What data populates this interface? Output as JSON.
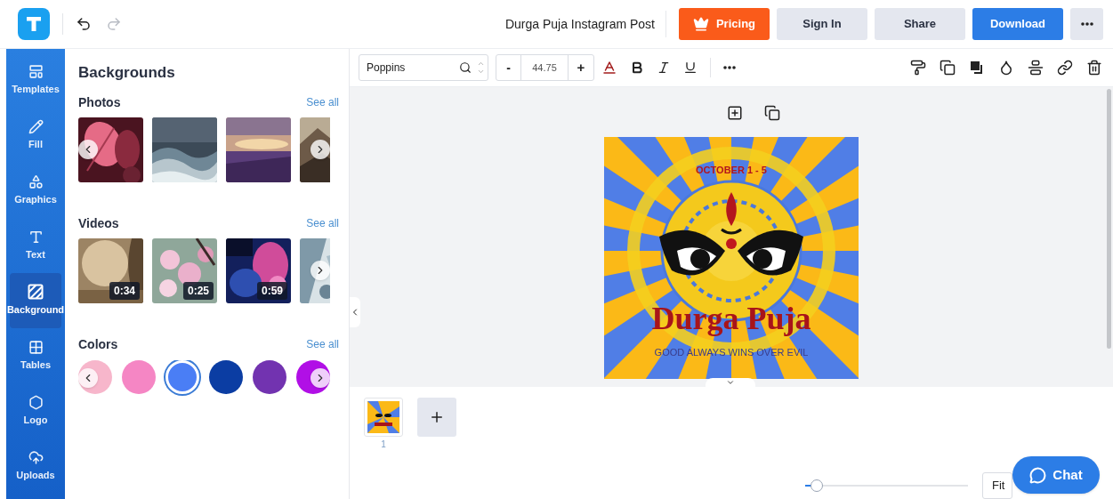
{
  "header": {
    "title": "Durga Puja Instagram Post",
    "buttons": [
      {
        "label": "Pricing",
        "kind": "pricing"
      },
      {
        "label": "Sign In",
        "kind": "secondary"
      },
      {
        "label": "Share",
        "kind": "secondary"
      },
      {
        "label": "Download",
        "kind": "primary"
      }
    ]
  },
  "sidebar": {
    "items": [
      {
        "label": "Templates",
        "kind": "templates",
        "selected": false
      },
      {
        "label": "Fill",
        "kind": "fill",
        "selected": false
      },
      {
        "label": "Graphics",
        "kind": "graphics",
        "selected": false
      },
      {
        "label": "Text",
        "kind": "text",
        "selected": false
      },
      {
        "label": "Background",
        "kind": "background",
        "selected": true
      },
      {
        "label": "Tables",
        "kind": "tables",
        "selected": false
      },
      {
        "label": "Logo",
        "kind": "logo",
        "selected": false
      },
      {
        "label": "Uploads",
        "kind": "uploads",
        "selected": false
      }
    ]
  },
  "panel": {
    "title": "Backgrounds",
    "sections": [
      {
        "kind": "photos",
        "title": "Photos",
        "link": "See all",
        "items": [
          {
            "kind": "picture"
          },
          {
            "kind": "picture"
          },
          {
            "kind": "picture"
          },
          {
            "kind": "picture"
          }
        ]
      },
      {
        "kind": "videos",
        "title": "Videos",
        "link": "See all",
        "items": [
          {
            "kind": "picture",
            "duration": "0:34"
          },
          {
            "kind": "picture",
            "duration": "0:25"
          },
          {
            "kind": "picture",
            "duration": "0:59"
          },
          {
            "kind": "picture"
          }
        ]
      },
      {
        "kind": "colors",
        "title": "Colors",
        "link": "See all",
        "items": [
          {
            "color": "#f7b6cb",
            "selected": false
          },
          {
            "color": "#f586c4",
            "selected": false
          },
          {
            "color": "#4a7ef5",
            "selected": true
          },
          {
            "color": "#0b3da3",
            "selected": false
          },
          {
            "color": "#7233b0",
            "selected": false
          },
          {
            "color": "#b10fe6",
            "selected": false
          }
        ]
      }
    ]
  },
  "toolbar": {
    "font": "Poppins",
    "font_size": "44.75",
    "minus": "-",
    "plus": "+"
  },
  "design": {
    "date": "OCTOBER 1 - 5",
    "title": "Durga Puja",
    "tagline": "GOOD ALWAYS WINS OVER EVIL"
  },
  "pages": [
    {
      "number": "1"
    }
  ],
  "zoom": {
    "level": 0.07,
    "fit": "Fit"
  },
  "chat": {
    "label": "Chat"
  }
}
